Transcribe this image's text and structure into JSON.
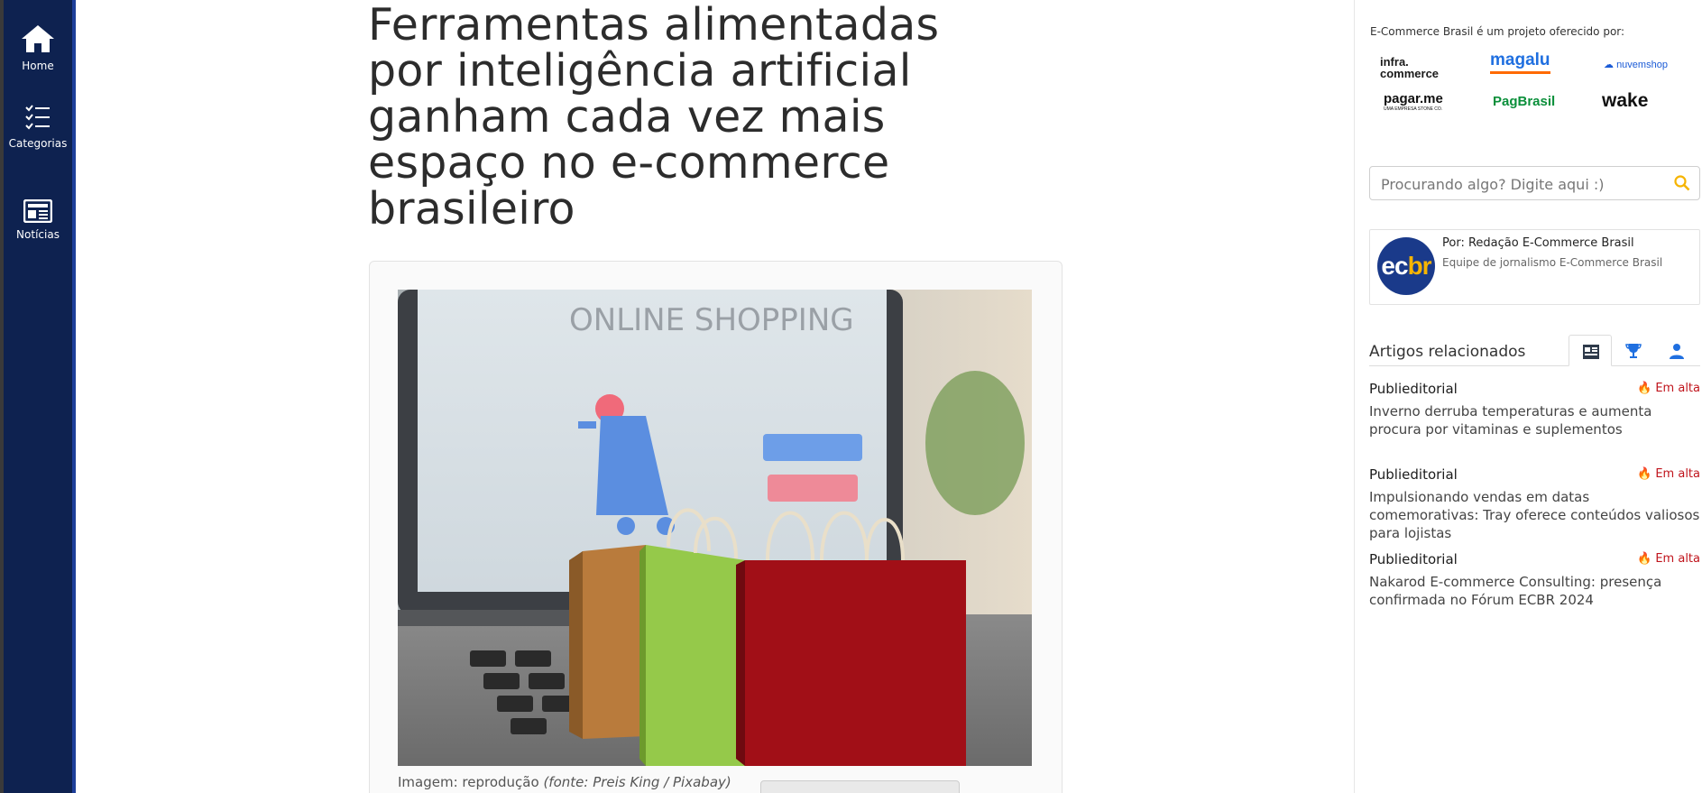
{
  "nav": {
    "items": [
      {
        "label": "Home",
        "icon": "home-icon"
      },
      {
        "label": "Categorias",
        "icon": "list-icon"
      },
      {
        "label": "Notícias",
        "icon": "newspaper-icon"
      }
    ]
  },
  "article": {
    "title": "Ferramentas alimentadas por inteligência artificial ganham cada vez mais espaço no e-commerce brasileiro",
    "photo_text": "ONLINE SHOPPING",
    "caption_prefix": "Imagem: reprodução",
    "caption_source": "(fonte: Preis King / Pixabay)"
  },
  "sidebar": {
    "sponsor_title": "E-Commerce Brasil é um projeto oferecido por:",
    "sponsors": [
      {
        "line1": "infra.",
        "line2": "commerce"
      },
      {
        "name": "magalu"
      },
      {
        "name": "nuvemshop"
      },
      {
        "name": "pagar.me",
        "sub": "UMA EMPRESA STONE CO."
      },
      {
        "name": "PagBrasil"
      },
      {
        "name": "wake"
      }
    ],
    "search_placeholder": "Procurando algo? Digite aqui :)",
    "author": {
      "avatar_a": "ec",
      "avatar_b": "br",
      "name": "Por: Redação E-Commerce Brasil",
      "role": "Equipe de jornalismo E-Commerce Brasil"
    },
    "related_title": "Artigos relacionados",
    "related": [
      {
        "category": "Publieditorial",
        "hot": "Em alta",
        "text": "Inverno derruba temperaturas e aumenta procura por vitaminas e suplementos"
      },
      {
        "category": "Publieditorial",
        "hot": "Em alta",
        "text": "Impulsionando vendas em datas comemorativas: Tray oferece conteúdos valiosos para lojistas"
      },
      {
        "category": "Publieditorial",
        "hot": "Em alta",
        "text": "Nakarod E-commerce Consulting: presença confirmada no Fórum ECBR 2024"
      }
    ]
  },
  "colors": {
    "nav_bg": "#0e2250",
    "accent_blue": "#1a3a8a",
    "hot_red": "#c0141c",
    "search_icon": "#f6b400"
  }
}
